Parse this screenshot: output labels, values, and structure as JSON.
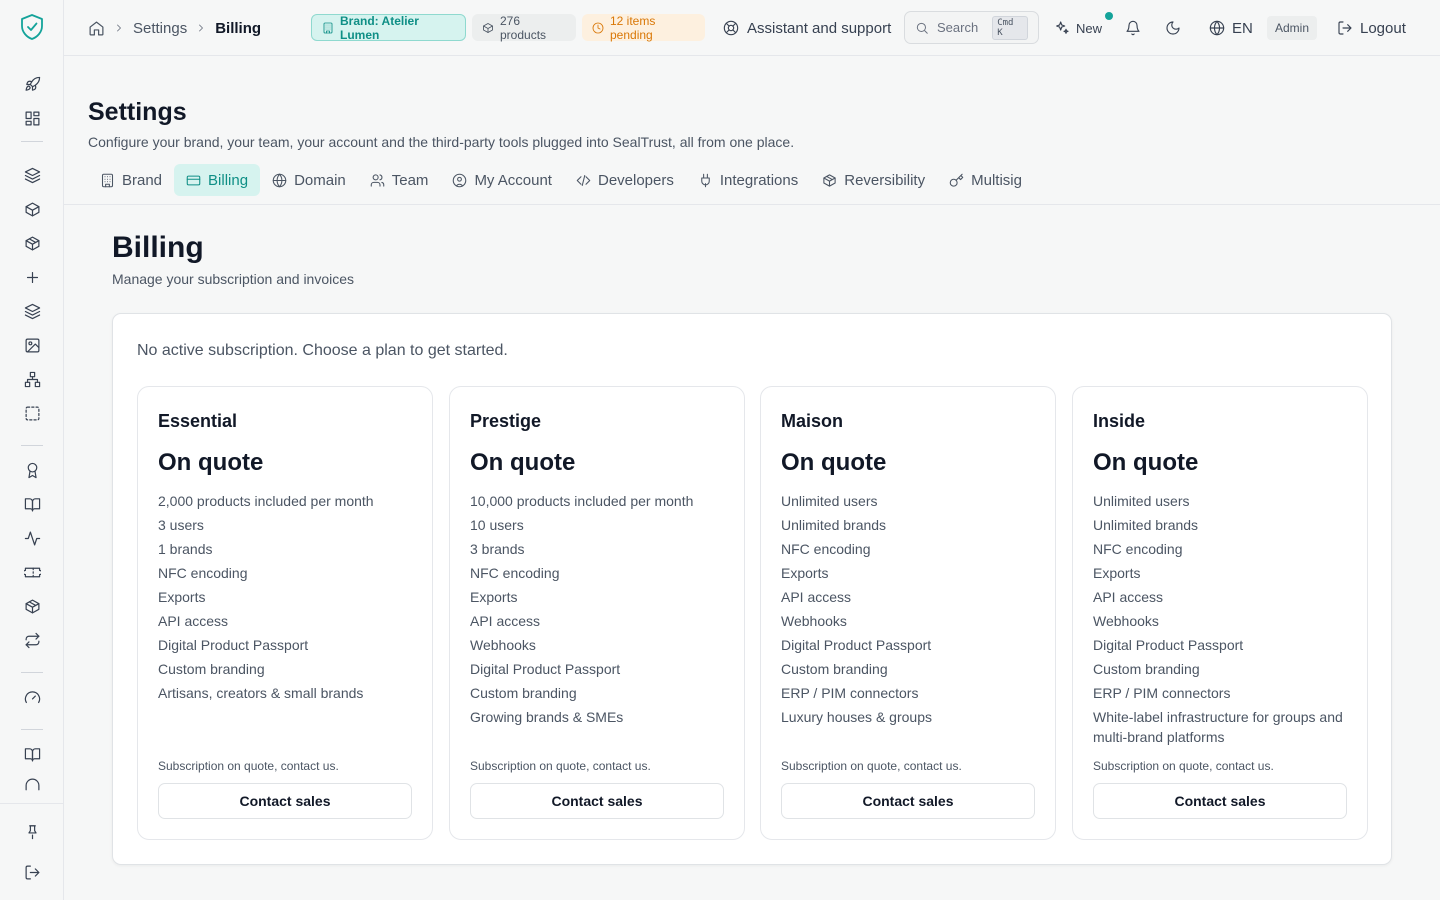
{
  "breadcrumb": {
    "parent": "Settings",
    "current": "Billing"
  },
  "topbar": {
    "brand_chip": "Brand: Atelier Lumen",
    "products_chip": "276 products",
    "pending_chip": "12 items pending",
    "assistant": "Assistant and support",
    "search_placeholder": "Search",
    "search_kbd": "Cmd K",
    "new_label": "New",
    "language": "EN",
    "role": "Admin",
    "logout": "Logout"
  },
  "page": {
    "title": "Settings",
    "subtitle": "Configure your brand, your team, your account and the third-party tools plugged into SealTrust, all from one place."
  },
  "tabs": [
    {
      "label": "Brand",
      "icon": "building-icon"
    },
    {
      "label": "Billing",
      "icon": "credit-card-icon"
    },
    {
      "label": "Domain",
      "icon": "globe-icon"
    },
    {
      "label": "Team",
      "icon": "users-icon"
    },
    {
      "label": "My Account",
      "icon": "user-circle-icon"
    },
    {
      "label": "Developers",
      "icon": "code-icon"
    },
    {
      "label": "Integrations",
      "icon": "plug-icon"
    },
    {
      "label": "Reversibility",
      "icon": "package-icon"
    },
    {
      "label": "Multisig",
      "icon": "key-icon"
    }
  ],
  "billing": {
    "title": "Billing",
    "subtitle": "Manage your subscription and invoices",
    "status_message": "No active subscription. Choose a plan to get started.",
    "plans": [
      {
        "name": "Essential",
        "price": "On quote",
        "features": [
          "2,000 products included per month",
          "3 users",
          "1 brands",
          "NFC encoding",
          "Exports",
          "API access",
          "Digital Product Passport",
          "Custom branding",
          "Artisans, creators & small brands"
        ],
        "note": "Subscription on quote, contact us.",
        "cta": "Contact sales"
      },
      {
        "name": "Prestige",
        "price": "On quote",
        "features": [
          "10,000 products included per month",
          "10 users",
          "3 brands",
          "NFC encoding",
          "Exports",
          "API access",
          "Webhooks",
          "Digital Product Passport",
          "Custom branding",
          "Growing brands & SMEs"
        ],
        "note": "Subscription on quote, contact us.",
        "cta": "Contact sales"
      },
      {
        "name": "Maison",
        "price": "On quote",
        "features": [
          "Unlimited users",
          "Unlimited brands",
          "NFC encoding",
          "Exports",
          "API access",
          "Webhooks",
          "Digital Product Passport",
          "Custom branding",
          "ERP / PIM connectors",
          "Luxury houses & groups"
        ],
        "note": "Subscription on quote, contact us.",
        "cta": "Contact sales"
      },
      {
        "name": "Inside",
        "price": "On quote",
        "features": [
          "Unlimited users",
          "Unlimited brands",
          "NFC encoding",
          "Exports",
          "API access",
          "Webhooks",
          "Digital Product Passport",
          "Custom branding",
          "ERP / PIM connectors",
          "White-label infrastructure for groups and multi-brand platforms"
        ],
        "note": "Subscription on quote, contact us.",
        "cta": "Contact sales"
      }
    ]
  },
  "colors": {
    "accent": "#14a39a",
    "accent_bg": "#d6f3ef",
    "warning": "#d97706"
  }
}
